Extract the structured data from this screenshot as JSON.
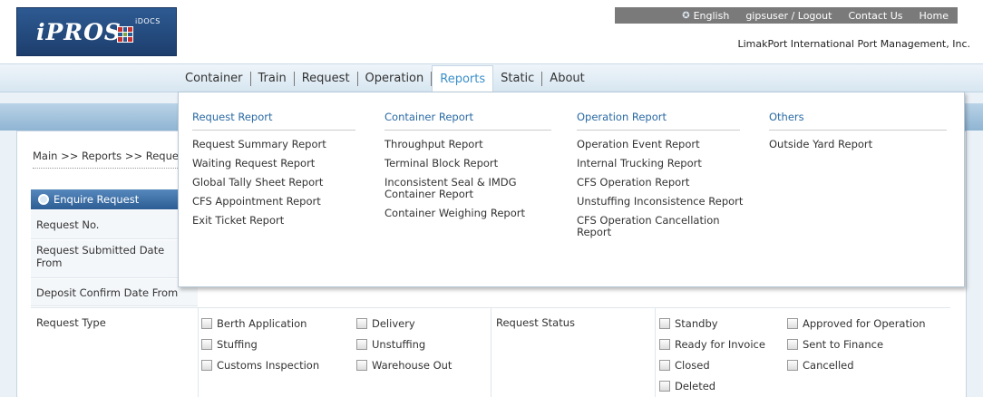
{
  "logo": {
    "name": "iPROS",
    "sup": "iDOCS"
  },
  "toplinks": {
    "language": "English",
    "user": "gipsuser / Logout",
    "contact": "Contact Us",
    "home": "Home"
  },
  "company": "LimakPort International Port Management, Inc.",
  "nav": [
    "Container",
    "Train",
    "Request",
    "Operation",
    "Reports",
    "Static",
    "About"
  ],
  "nav_active": "Reports",
  "breadcrumb": "Main >> Reports >> Request",
  "panel": {
    "title": "Enquire Request"
  },
  "form_labels": {
    "request_no": "Request No.",
    "submitted_from": "Request Submitted Date From",
    "deposit_from": "Deposit Confirm Date From",
    "request_type": "Request Type",
    "request_status": "Request Status"
  },
  "request_types": [
    "Berth Application",
    "Delivery",
    "Stuffing",
    "Unstuffing",
    "Customs Inspection",
    "Warehouse Out"
  ],
  "request_statuses": [
    "Standby",
    "Approved for Operation",
    "Ready for Invoice",
    "Sent to Finance",
    "Closed",
    "Cancelled",
    "Deleted"
  ],
  "dropdown": {
    "request_report": {
      "head": "Request Report",
      "items": [
        "Request Summary Report",
        "Waiting Request Report",
        "Global Tally Sheet Report",
        "CFS Appointment Report",
        "Exit Ticket Report"
      ]
    },
    "container_report": {
      "head": "Container Report",
      "items": [
        "Throughput Report",
        "Terminal Block Report",
        "Inconsistent Seal & IMDG Container Report",
        "Container Weighing Report"
      ]
    },
    "operation_report": {
      "head": "Operation Report",
      "items": [
        "Operation Event Report",
        "Internal Trucking Report",
        "CFS Operation Report",
        "Unstuffing Inconsistence Report",
        "CFS Operation Cancellation Report"
      ]
    },
    "others": {
      "head": "Others",
      "items": [
        "Outside Yard Report"
      ]
    }
  },
  "colors": {
    "accent": "#3a8fc9",
    "panel_head": "#2c5d94",
    "menu_head": "#2a6aa4"
  }
}
